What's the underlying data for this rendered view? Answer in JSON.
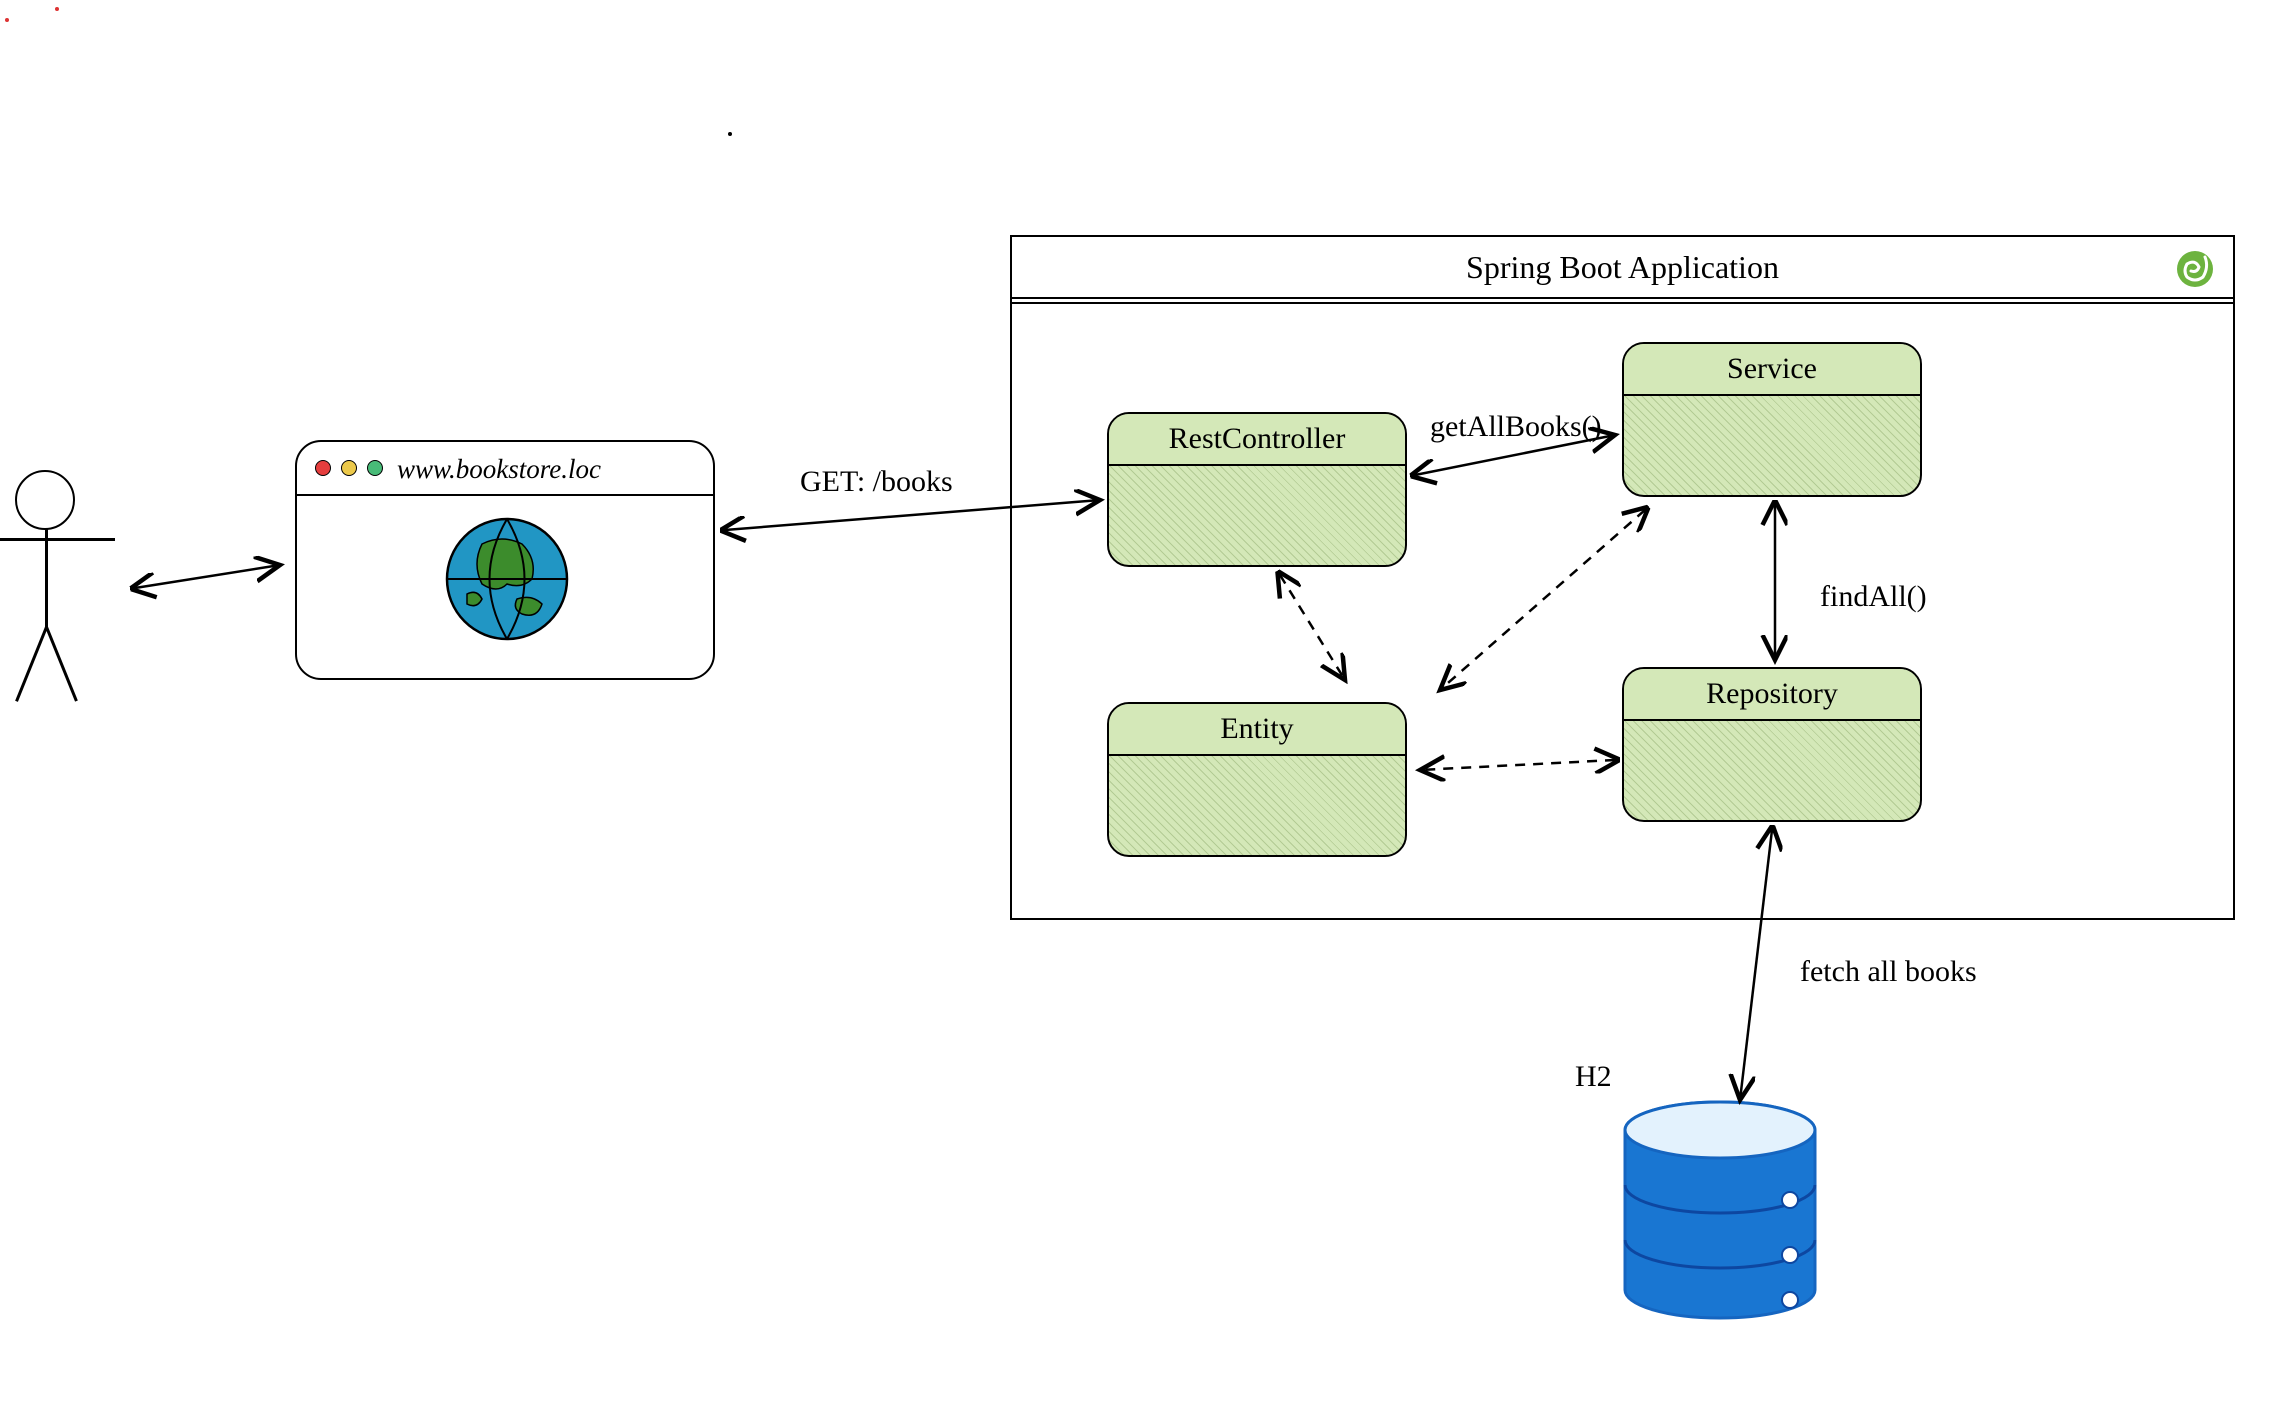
{
  "container": {
    "title": "Spring Boot Application"
  },
  "browser": {
    "url": "www.bookstore.loc"
  },
  "components": {
    "restcontroller": "RestController",
    "service": "Service",
    "entity": "Entity",
    "repository": "Repository"
  },
  "arrows": {
    "httpRequest": "GET: /books",
    "getAllBooks": "getAllBooks()",
    "findAll": "findAll()",
    "fetchAll": "fetch all books"
  },
  "database": {
    "label": "H2"
  }
}
